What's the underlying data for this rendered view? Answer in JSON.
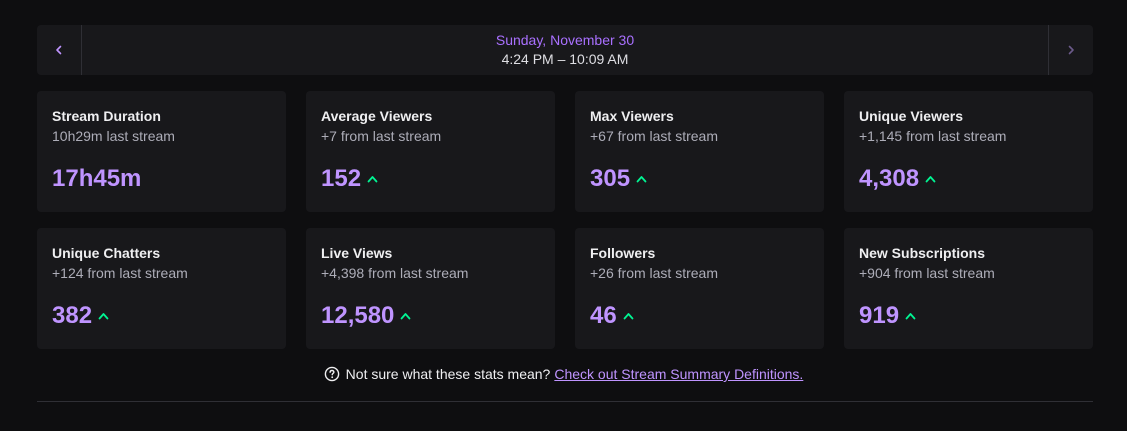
{
  "date_nav": {
    "day": "Sunday, November 30",
    "range": "4:24 PM – 10:09 AM"
  },
  "stats": [
    {
      "title": "Stream Duration",
      "sub": "10h29m last stream",
      "value": "17h45m",
      "trend": "none"
    },
    {
      "title": "Average Viewers",
      "sub": "+7 from last stream",
      "value": "152",
      "trend": "up"
    },
    {
      "title": "Max Viewers",
      "sub": "+67 from last stream",
      "value": "305",
      "trend": "up"
    },
    {
      "title": "Unique Viewers",
      "sub": "+1,145 from last stream",
      "value": "4,308",
      "trend": "up"
    },
    {
      "title": "Unique Chatters",
      "sub": "+124 from last stream",
      "value": "382",
      "trend": "up"
    },
    {
      "title": "Live Views",
      "sub": "+4,398 from last stream",
      "value": "12,580",
      "trend": "up"
    },
    {
      "title": "Followers",
      "sub": "+26 from last stream",
      "value": "46",
      "trend": "up"
    },
    {
      "title": "New Subscriptions",
      "sub": "+904 from last stream",
      "value": "919",
      "trend": "up"
    }
  ],
  "help": {
    "question": "Not sure what these stats mean?",
    "link": "Check out Stream Summary Definitions."
  },
  "colors": {
    "accent": "#bf94ff",
    "date_accent": "#a970ff",
    "trend_up": "#00f593",
    "card_bg": "#18181b",
    "page_bg": "#0e0e10"
  },
  "icons": {
    "prev": "chevron-left-icon",
    "next": "chevron-right-icon",
    "trend": "arrow-up-icon",
    "help": "question-circle-icon"
  }
}
